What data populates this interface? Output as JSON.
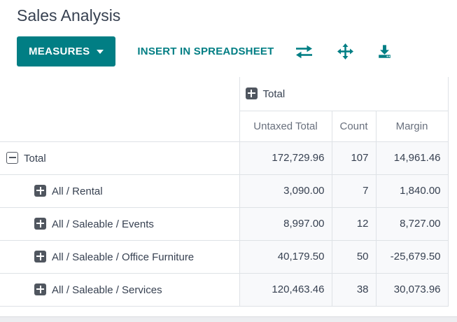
{
  "page_title": "Sales Analysis",
  "colors": {
    "accent": "#017e84",
    "text_dark": "#374151",
    "header_gray": "#69707d",
    "cell_bg": "#f8f9fb",
    "border": "#dee2e6"
  },
  "toolbar": {
    "measures_label": "MEASURES",
    "insert_label": "INSERT IN SPREADSHEET",
    "icons": [
      {
        "name": "flip-axis-icon"
      },
      {
        "name": "expand-all-icon"
      },
      {
        "name": "download-icon"
      }
    ]
  },
  "pivot": {
    "col_group_header": "Total",
    "measure_headers": {
      "untaxed": "Untaxed Total",
      "count": "Count",
      "margin": "Margin"
    },
    "rows": [
      {
        "label": "Total",
        "level": 0,
        "expanded": true,
        "untaxed_total": "172,729.96",
        "count": "107",
        "margin": "14,961.46"
      },
      {
        "label": "All / Rental",
        "level": 1,
        "expanded": false,
        "untaxed_total": "3,090.00",
        "count": "7",
        "margin": "1,840.00"
      },
      {
        "label": "All / Saleable / Events",
        "level": 1,
        "expanded": false,
        "untaxed_total": "8,997.00",
        "count": "12",
        "margin": "8,727.00"
      },
      {
        "label": "All / Saleable / Office Furniture",
        "level": 1,
        "expanded": false,
        "untaxed_total": "40,179.50",
        "count": "50",
        "margin": "-25,679.50"
      },
      {
        "label": "All / Saleable / Services",
        "level": 1,
        "expanded": false,
        "untaxed_total": "120,463.46",
        "count": "38",
        "margin": "30,073.96"
      }
    ]
  }
}
